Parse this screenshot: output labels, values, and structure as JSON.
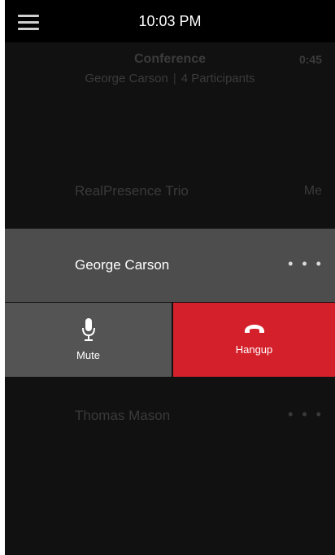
{
  "status_bar": {
    "time": "10:03 PM"
  },
  "conference": {
    "title": "Conference",
    "timer": "0:45",
    "host": "George Carson",
    "participants": "4 Participants"
  },
  "participants": {
    "self": {
      "name": "RealPresence Trio",
      "tag": "Me"
    },
    "selected": {
      "name": "George Carson",
      "more": "• • •"
    },
    "other": {
      "name": "Thomas Mason",
      "more": "• • •"
    }
  },
  "actions": {
    "mute_label": "Mute",
    "hangup_label": "Hangup",
    "mute_icon": "microphone-icon",
    "hangup_icon": "phone-hangup-icon"
  },
  "colors": {
    "hangup_bg": "#d4202b",
    "selected_row_bg": "#4d4d4d",
    "mute_bg": "#545454"
  }
}
